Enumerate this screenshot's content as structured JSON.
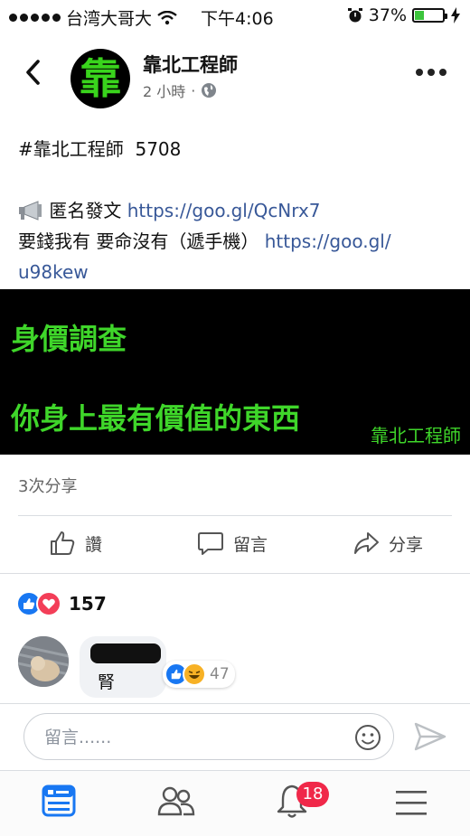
{
  "status_bar": {
    "carrier": "台湾大哥大",
    "time": "下午4:06",
    "battery_percent": "37%",
    "battery_level": 0.37
  },
  "post_header": {
    "page_name": "靠北工程師",
    "avatar_text": "靠",
    "time_ago": "2 小時",
    "separator": "·",
    "privacy_icon": "globe-icon"
  },
  "post": {
    "hashtag": "#靠北工程師",
    "number": "5708",
    "anon_label": "匿名發文",
    "anon_link": "https://goo.gl/QcNrx7",
    "slogan": "要錢我有 要命沒有（遞手機）",
    "slogan_link_part1": "https://goo.gl/",
    "slogan_link_part2": "u98kew",
    "image": {
      "line1": "身價調查",
      "line2": "你身上最有價值的東西",
      "watermark": "靠北工程師",
      "text_color": "#3fd62a"
    }
  },
  "share_count": "3次分享",
  "actions": {
    "like": "讚",
    "comment": "留言",
    "share": "分享"
  },
  "reactions": {
    "count": "157",
    "icons": [
      "like-icon",
      "love-icon"
    ]
  },
  "comment": {
    "text": "腎",
    "reaction_count": "47",
    "reaction_icons": [
      "like-icon",
      "haha-icon"
    ]
  },
  "comment_input": {
    "placeholder": "留言......"
  },
  "tabs": {
    "notifications_badge": "18"
  },
  "colors": {
    "link": "#385898",
    "facebook_blue": "#1877f2",
    "badge_red": "#f02849"
  }
}
